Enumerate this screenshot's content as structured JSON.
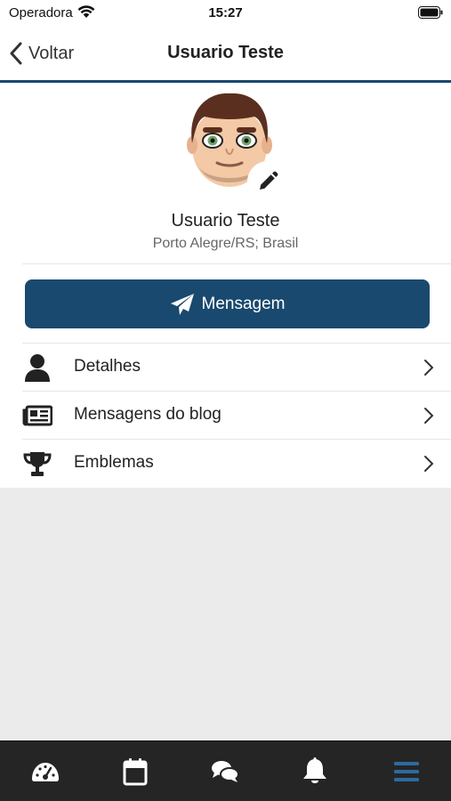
{
  "status_bar": {
    "carrier": "Operadora",
    "time": "15:27"
  },
  "nav": {
    "back_label": "Voltar",
    "title": "Usuario Teste"
  },
  "profile": {
    "name": "Usuario Teste",
    "location": "Porto Alegre/RS; Brasil"
  },
  "message_button": {
    "label": "Mensagem",
    "icon": "paper-plane-icon"
  },
  "menu": [
    {
      "label": "Detalhes",
      "icon": "user-icon"
    },
    {
      "label": "Mensagens do blog",
      "icon": "newspaper-icon"
    },
    {
      "label": "Emblemas",
      "icon": "trophy-icon"
    }
  ],
  "tabbar": [
    {
      "icon": "dashboard-icon",
      "active": false
    },
    {
      "icon": "calendar-icon",
      "active": false
    },
    {
      "icon": "chat-icon",
      "active": false
    },
    {
      "icon": "bell-icon",
      "active": false
    },
    {
      "icon": "menu-icon",
      "active": true
    }
  ],
  "colors": {
    "primary": "#19496e",
    "tabbar_bg": "#252525",
    "tab_active": "#2d6a9f",
    "tab_inactive": "#ffffff"
  }
}
